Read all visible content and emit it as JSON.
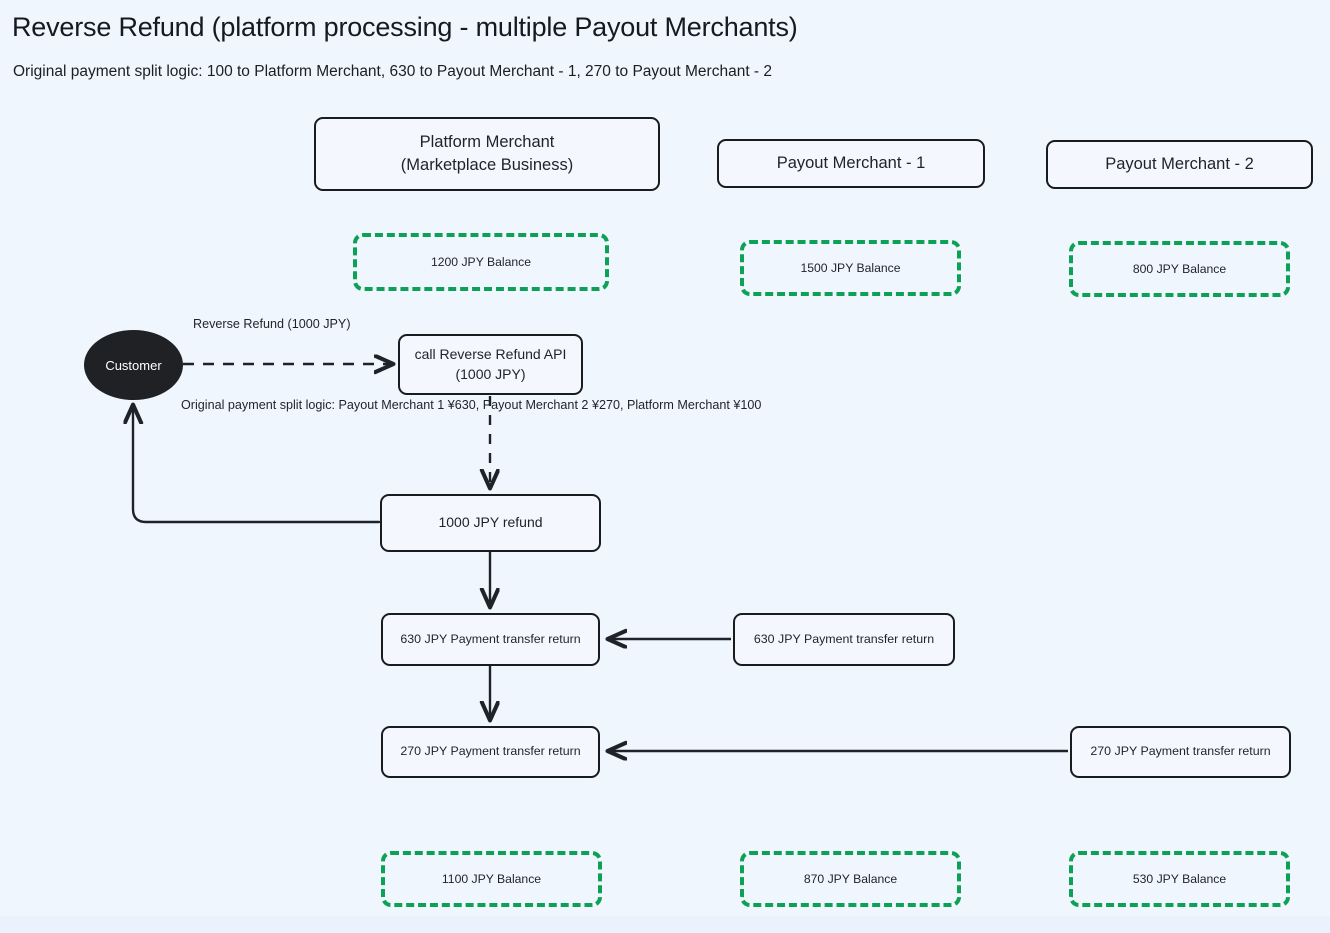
{
  "header": {
    "title": "Reverse Refund (platform processing - multiple Payout Merchants)",
    "subtitle": "Original payment split logic: 100 to Platform Merchant, 630 to Payout Merchant - 1, 270 to Payout Merchant - 2"
  },
  "colors": {
    "background": "#eff6fe",
    "node_border": "#191c1f",
    "node_fill": "#f4f8fe",
    "balance_border": "#0ca154",
    "actor_fill": "#1f2124",
    "edge_stroke": "#1f2329",
    "text": "#1f2329"
  },
  "merchants": [
    {
      "id": "platform-merchant",
      "title_line1": "Platform Merchant",
      "title_line2": "(Marketplace Business)",
      "balance_before": "1200 JPY Balance",
      "balance_after": "1100 JPY Balance"
    },
    {
      "id": "payout-merchant-1",
      "title_line1": "Payout Merchant - 1",
      "title_line2": "",
      "balance_before": "1500 JPY Balance",
      "balance_after": "870 JPY Balance"
    },
    {
      "id": "payout-merchant-2",
      "title_line1": "Payout Merchant - 2",
      "title_line2": "",
      "balance_before": "800 JPY Balance",
      "balance_after": "530 JPY Balance"
    }
  ],
  "actor": {
    "label": "Customer"
  },
  "flow": {
    "api_call_line1": "call Reverse Refund API",
    "api_call_line2": "(1000 JPY)",
    "refund": "1000 JPY refund",
    "transfer_return_630": "630 JPY Payment transfer return",
    "transfer_return_270": "270 JPY Payment transfer return",
    "payout1_transfer_return": "630 JPY Payment transfer return",
    "payout2_transfer_return": "270 JPY Payment transfer return"
  },
  "edge_labels": {
    "reverse_refund_line1": "Reverse Refund",
    "reverse_refund_line2": "(1000 JPY)",
    "split_logic_line1": "Original payment split logic:",
    "split_logic_line2": "Payout Merchant 1 ¥630,",
    "split_logic_line3": "Payout Merchant 2 ¥270,",
    "split_logic_line4": "Platform Merchant ¥100"
  }
}
